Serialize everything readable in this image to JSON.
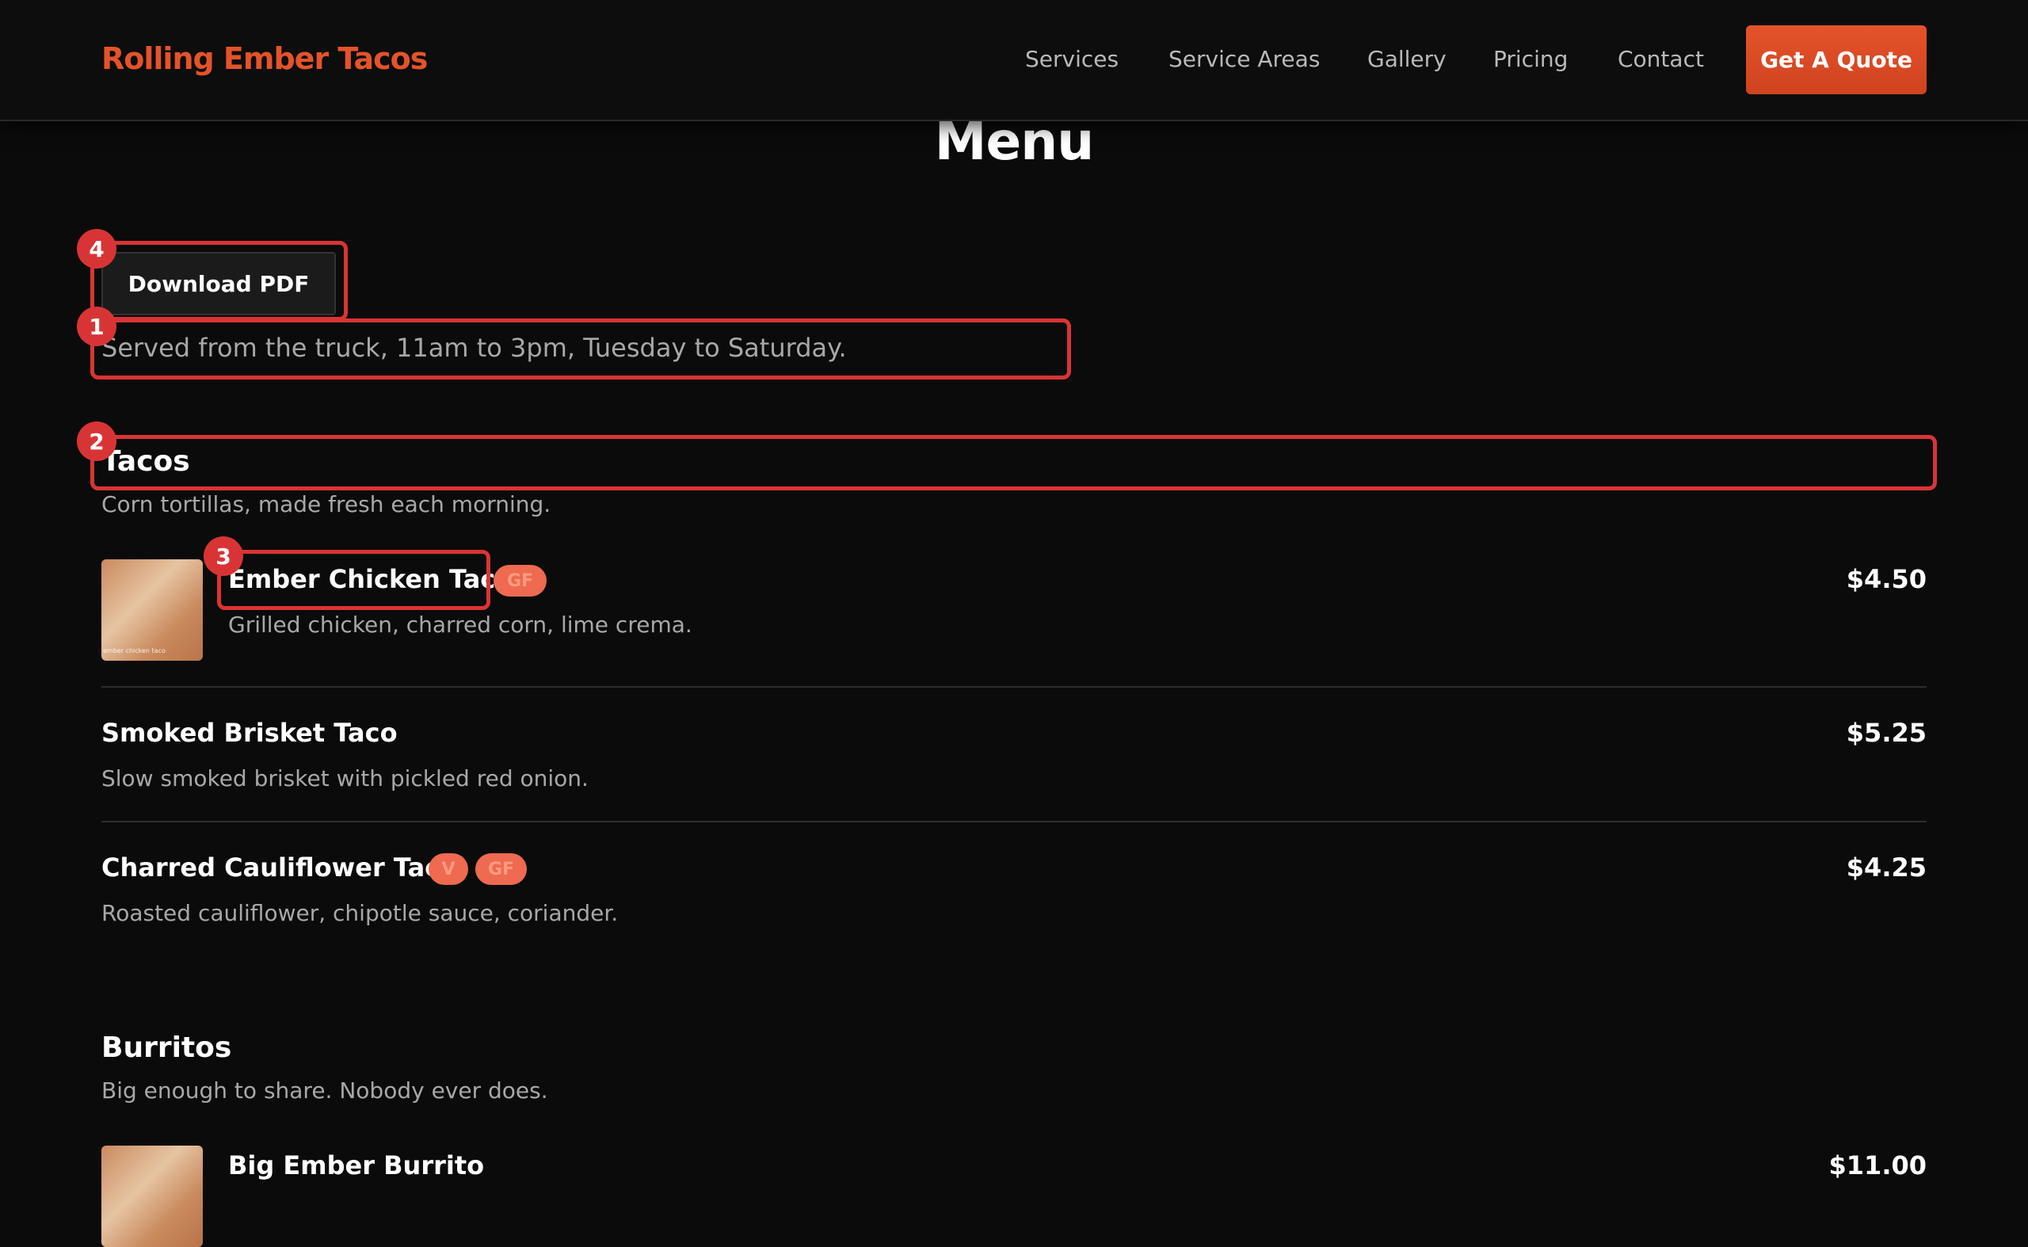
{
  "header": {
    "logo": "Rolling Ember Tacos",
    "nav": [
      "Services",
      "Service Areas",
      "Gallery",
      "Pricing",
      "Contact"
    ],
    "cta_label": "Get A Quote"
  },
  "page": {
    "title": "Menu",
    "download_label": "Download PDF",
    "intro": "Served from the truck, 11am to 3pm, Tuesday to Saturday."
  },
  "markers": [
    "1",
    "2",
    "3",
    "4"
  ],
  "sections": [
    {
      "title": "Tacos",
      "description": "Corn tortillas, made fresh each morning.",
      "items": [
        {
          "name": "Ember Chicken Taco",
          "description": "Grilled chicken, charred corn, lime crema.",
          "price": "$4.50",
          "badges": [
            "GF"
          ],
          "image_caption": "ember chicken taco"
        },
        {
          "name": "Smoked Brisket Taco",
          "description": "Slow smoked brisket with pickled red onion.",
          "price": "$5.25",
          "badges": []
        },
        {
          "name": "Charred Cauliflower Taco",
          "description": "Roasted cauliflower, chipotle sauce, coriander.",
          "price": "$4.25",
          "badges": [
            "V",
            "GF"
          ]
        }
      ]
    },
    {
      "title": "Burritos",
      "description": "Big enough to share. Nobody ever does.",
      "items": [
        {
          "name": "Big Ember Burrito",
          "price": "$11.00",
          "badges": []
        }
      ]
    }
  ],
  "colors": {
    "accent": "#e4532a",
    "background": "#0b0b0b",
    "highlight": "#d93435",
    "badge": "#ee6a50"
  }
}
